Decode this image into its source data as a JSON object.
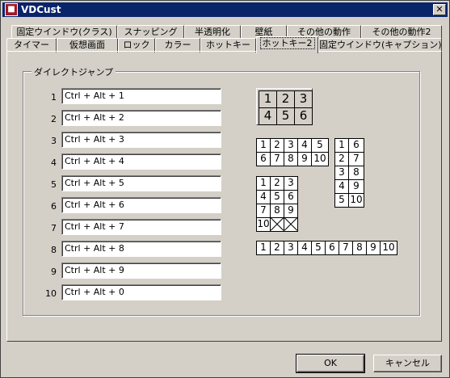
{
  "window": {
    "title": "VDCust"
  },
  "tabs_row1": [
    "固定ウインドウ(クラス)",
    "スナッピング",
    "半透明化",
    "壁紙",
    "その他の動作",
    "その他の動作2"
  ],
  "tabs_row2": [
    "タイマー",
    "仮想画面",
    "ロック",
    "カラー",
    "ホットキー",
    "ホットキー2",
    "固定ウインドウ(キャプション)"
  ],
  "active_tab": "ホットキー2",
  "group": {
    "title": "ダイレクトジャンプ",
    "rows": [
      {
        "label": "1",
        "value": "Ctrl + Alt + 1"
      },
      {
        "label": "2",
        "value": "Ctrl + Alt + 2"
      },
      {
        "label": "3",
        "value": "Ctrl + Alt + 3"
      },
      {
        "label": "4",
        "value": "Ctrl + Alt + 4"
      },
      {
        "label": "5",
        "value": "Ctrl + Alt + 5"
      },
      {
        "label": "6",
        "value": "Ctrl + Alt + 6"
      },
      {
        "label": "7",
        "value": "Ctrl + Alt + 7"
      },
      {
        "label": "8",
        "value": "Ctrl + Alt + 8"
      },
      {
        "label": "9",
        "value": "Ctrl + Alt + 9"
      },
      {
        "label": "10",
        "value": "Ctrl + Alt + 0"
      }
    ]
  },
  "layouts": {
    "grid_3x2": [
      "1",
      "2",
      "3",
      "4",
      "5",
      "6"
    ],
    "grid_5x2": [
      "1",
      "2",
      "3",
      "4",
      "5",
      "6",
      "7",
      "8",
      "9",
      "10"
    ],
    "grid_2x5": [
      "1",
      "6",
      "2",
      "7",
      "3",
      "8",
      "4",
      "9",
      "5",
      "10"
    ],
    "grid_3x4": [
      "1",
      "2",
      "3",
      "4",
      "5",
      "6",
      "7",
      "8",
      "9",
      "10",
      "",
      ""
    ],
    "grid_10x1": [
      "1",
      "2",
      "3",
      "4",
      "5",
      "6",
      "7",
      "8",
      "9",
      "10"
    ]
  },
  "buttons": {
    "ok": "OK",
    "cancel": "キャンセル"
  }
}
